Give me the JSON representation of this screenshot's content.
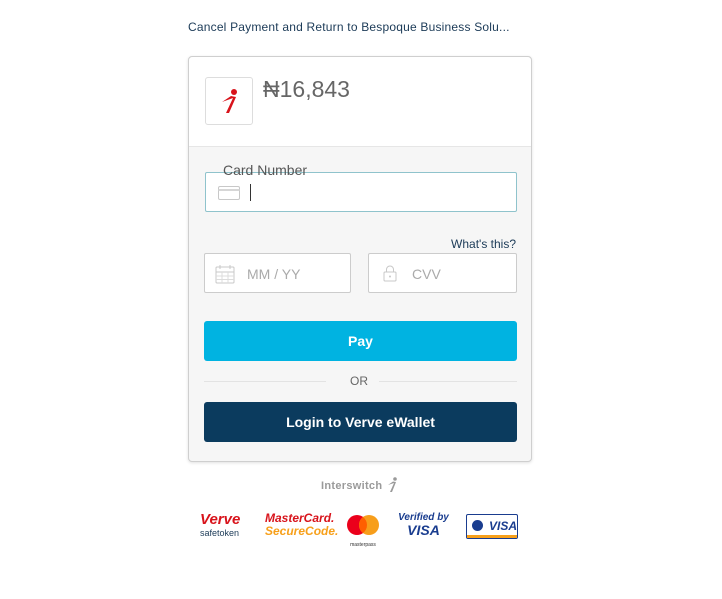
{
  "header": {
    "cancel_link": "Cancel Payment and Return to Bespoque Business Solu..."
  },
  "payment": {
    "amount": "₦16,843"
  },
  "form": {
    "card_number_label": "Card Number",
    "card_number_value": "",
    "whats_this_link": "What's this?",
    "expiry_placeholder": "MM / YY",
    "cvv_placeholder": "CVV"
  },
  "actions": {
    "pay_label": "Pay",
    "or_label": "OR",
    "wallet_label": "Login to Verve eWallet"
  },
  "footer": {
    "brand_name": "Interswitch",
    "logos": {
      "verve_top": "Verve",
      "verve_bottom": "safetoken",
      "mastercard_top": "MasterCard.",
      "mastercard_bottom": "SecureCode.",
      "masterpass": "masterpass",
      "vbv_top": "Verified by",
      "vbv_bottom": "VISA",
      "visa": "VISA"
    }
  },
  "colors": {
    "primary": "#00b3e1",
    "wallet": "#0b3b5e",
    "link": "#1b3a57",
    "brand_red": "#d8131b"
  }
}
